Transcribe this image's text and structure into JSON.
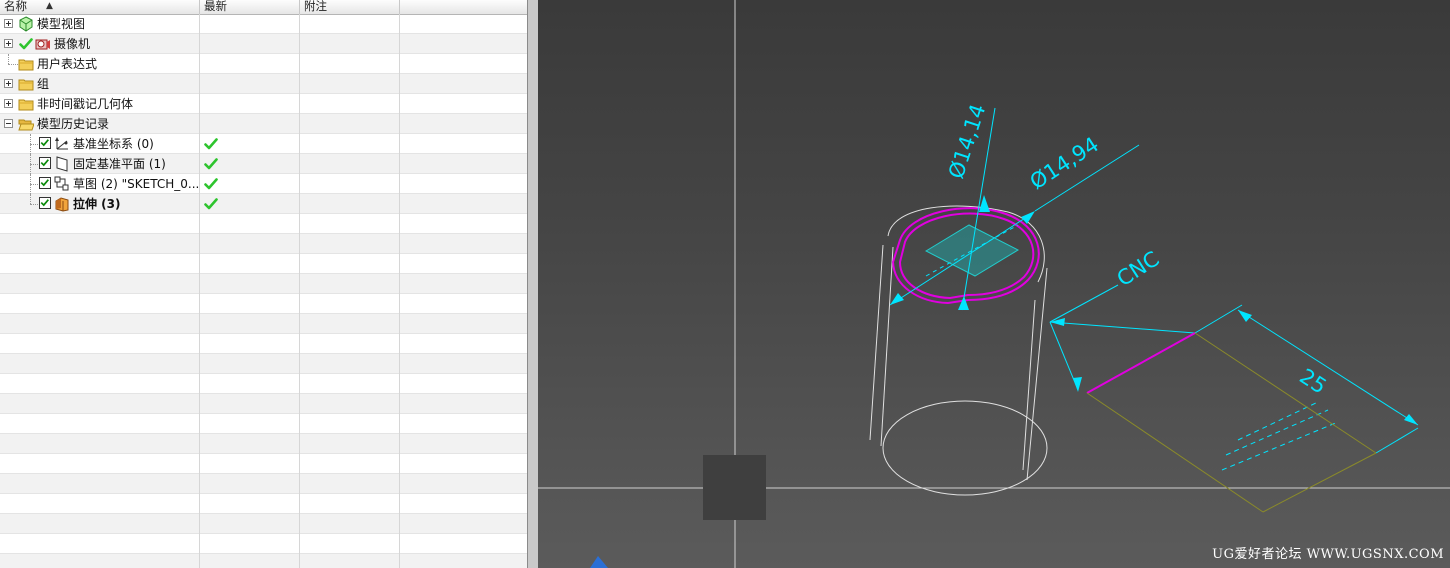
{
  "navigator": {
    "columns": [
      "名称",
      "最新",
      "附注"
    ],
    "rows": [
      {
        "label": "模型视图",
        "icon": "model-views-icon",
        "expander": "plus",
        "indent": 0
      },
      {
        "label": "摄像机",
        "icon": "camera-icon",
        "expander": "plus",
        "indent": 0,
        "prefix_check": true
      },
      {
        "label": "用户表达式",
        "icon": "folder-icon",
        "expander": "none",
        "indent": 0
      },
      {
        "label": "组",
        "icon": "folder-icon",
        "expander": "plus",
        "indent": 0
      },
      {
        "label": "非时间戳记几何体",
        "icon": "folder-icon",
        "expander": "plus",
        "indent": 0
      },
      {
        "label": "模型历史记录",
        "icon": "folder-open-icon",
        "expander": "minus",
        "indent": 0
      },
      {
        "label": "基准坐标系 (0)",
        "icon": "datum-csys-icon",
        "checkbox": true,
        "latest": true,
        "indent": 1
      },
      {
        "label": "固定基准平面 (1)",
        "icon": "datum-plane-icon",
        "checkbox": true,
        "latest": true,
        "indent": 1
      },
      {
        "label": "草图 (2) \"SKETCH_0...",
        "icon": "sketch-icon",
        "checkbox": true,
        "latest": true,
        "indent": 1
      },
      {
        "label": "拉伸 (3)",
        "icon": "extrude-icon",
        "checkbox": true,
        "latest": true,
        "indent": 1,
        "bold": true
      }
    ]
  },
  "viewport": {
    "dimensions": {
      "dia_inner": "Ø14,14",
      "dia_outer": "Ø14,94",
      "note": "CNC",
      "length": "25"
    },
    "colors": {
      "dimension": "#00e5ff",
      "highlight": "#e000e0",
      "wire": "#e8e8e8",
      "sheet_edge": "#8a8a2a",
      "background_top": "#3a3a3a",
      "background_bottom": "#5b5b5b"
    }
  },
  "watermark": "UG爱好者论坛 WWW.UGSNX.COM"
}
